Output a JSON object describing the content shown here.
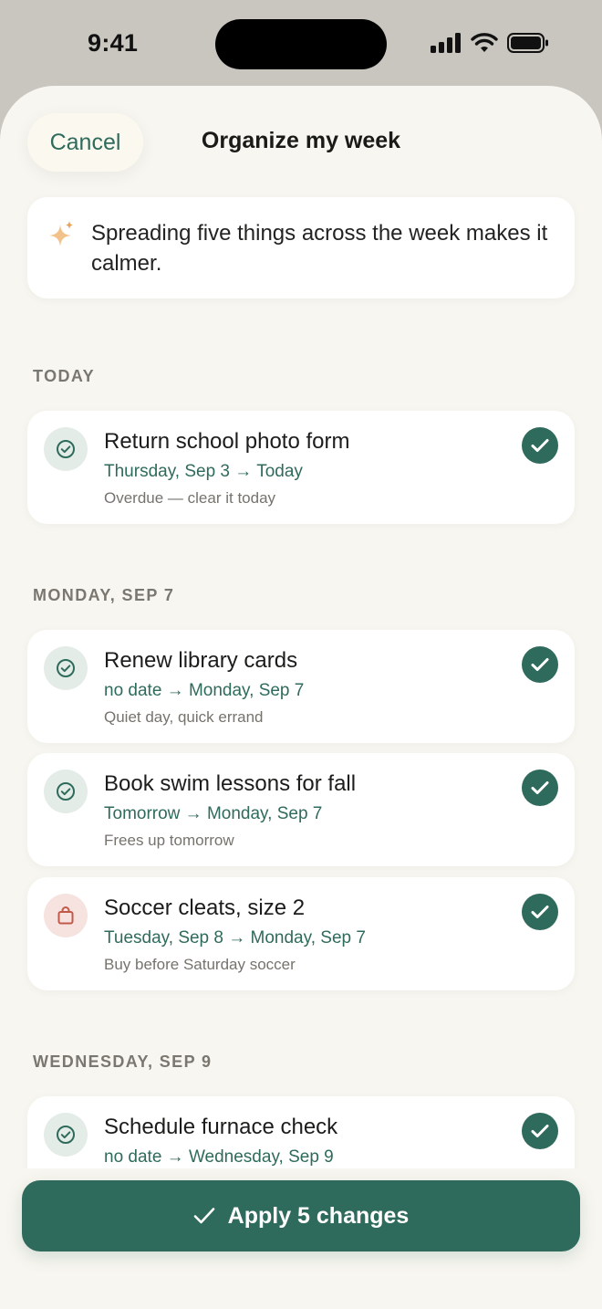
{
  "status": {
    "time": "9:41"
  },
  "header": {
    "cancel_label": "Cancel",
    "title": "Organize my week"
  },
  "hint": {
    "icon": "sparkle-icon",
    "text": "Spreading five things across the week makes it calmer."
  },
  "sections": [
    {
      "label": "TODAY",
      "tasks": [
        {
          "icon": "check-circle-icon",
          "title": "Return school photo form",
          "move": "Thursday, Sep 3 → Today",
          "note": "Overdue — clear it today",
          "selected": true
        }
      ]
    },
    {
      "label": "MONDAY, SEP 7",
      "tasks": [
        {
          "icon": "check-circle-icon",
          "title": "Renew library cards",
          "move": "no date → Monday, Sep 7",
          "note": "Quiet day, quick errand",
          "selected": true
        },
        {
          "icon": "check-circle-icon",
          "title": "Book swim lessons for fall",
          "move": "Tomorrow → Monday, Sep 7",
          "note": "Frees up tomorrow",
          "selected": true
        },
        {
          "icon": "shopping-bag-icon",
          "title": "Soccer cleats, size 2",
          "move": "Tuesday, Sep 8 → Monday, Sep 7",
          "note": "Buy before Saturday soccer",
          "selected": true
        }
      ]
    },
    {
      "label": "WEDNESDAY, SEP 9",
      "tasks": [
        {
          "icon": "check-circle-icon",
          "title": "Schedule furnace check",
          "move": "no date → Wednesday, Sep 9",
          "note": "",
          "selected": true
        }
      ]
    }
  ],
  "apply": {
    "label": "Apply 5 changes"
  },
  "colors": {
    "accent": "#2f6b5c",
    "background": "#f8f6f0",
    "shop_tint": "#f6e2df",
    "task_tint": "#e4ece7"
  }
}
